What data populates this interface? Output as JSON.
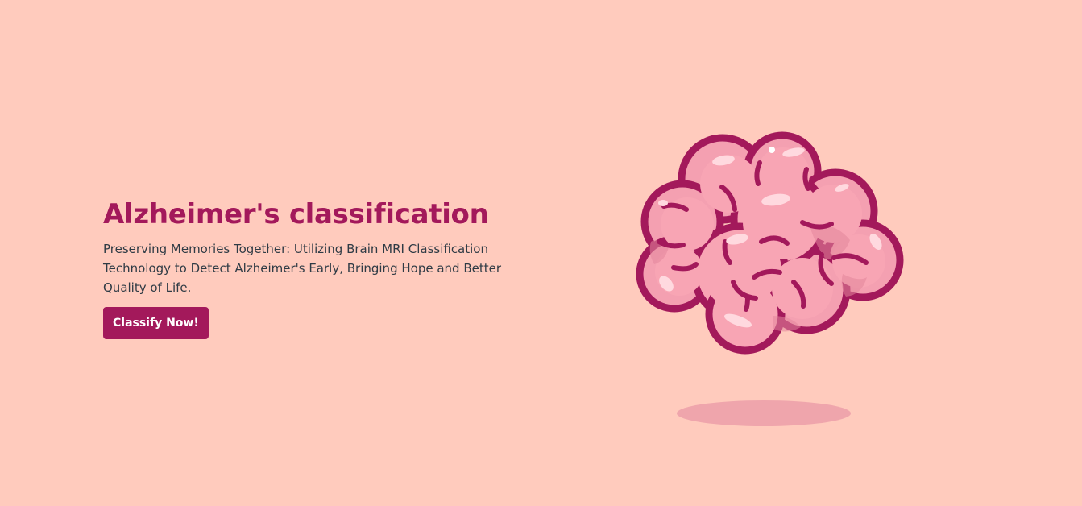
{
  "hero": {
    "title": "Alzheimer's classification",
    "subtitle": "Preserving Memories Together: Utilizing Brain MRI Classification Technology to Detect Alzheimer's Early, Bringing Hope and Better Quality of Life.",
    "cta_label": "Classify Now!"
  },
  "illustration": {
    "icon": "brain-icon"
  },
  "colors": {
    "background": "#ffcbbd",
    "accent": "#a3195b",
    "text": "#2f3b45",
    "brain_fill": "#f8a5b4",
    "brain_shade": "#e4879c",
    "brain_highlight": "#ffd9df",
    "shadow": "#efa5ac"
  }
}
